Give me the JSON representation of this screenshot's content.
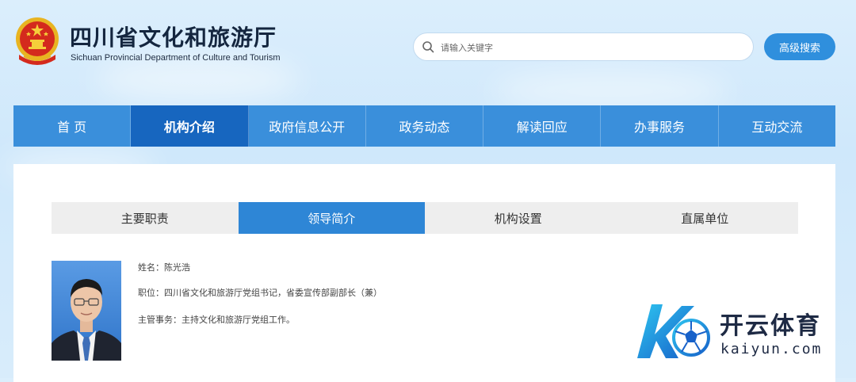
{
  "header": {
    "site_title": "四川省文化和旅游厅",
    "site_subtitle": "Sichuan Provincial Department of Culture and Tourism",
    "search_placeholder": "请输入关键字",
    "advanced_search_label": "高级搜索"
  },
  "nav": {
    "items": [
      {
        "label": "首  页"
      },
      {
        "label": "机构介绍"
      },
      {
        "label": "政府信息公开"
      },
      {
        "label": "政务动态"
      },
      {
        "label": "解读回应"
      },
      {
        "label": "办事服务"
      },
      {
        "label": "互动交流"
      }
    ],
    "active_index": 1
  },
  "sub_tabs": {
    "items": [
      {
        "label": "主要职责"
      },
      {
        "label": "领导简介"
      },
      {
        "label": "机构设置"
      },
      {
        "label": "直属单位"
      }
    ],
    "active_index": 1
  },
  "leader": {
    "name_line": "姓名：陈光浩",
    "position_line": "职位：四川省文化和旅游厅党组书记，省委宣传部副部长（兼）",
    "duties_line": "主管事务：主持文化和旅游厅党组工作。"
  },
  "watermark": {
    "brand": "开云体育",
    "domain": "kaiyun.com"
  },
  "colors": {
    "nav_bg": "#3a8fdb",
    "nav_active": "#1766bf",
    "tab_active": "#2e86d6",
    "tab_bg": "#eeeeee",
    "button_bg": "#2f8fdd"
  }
}
